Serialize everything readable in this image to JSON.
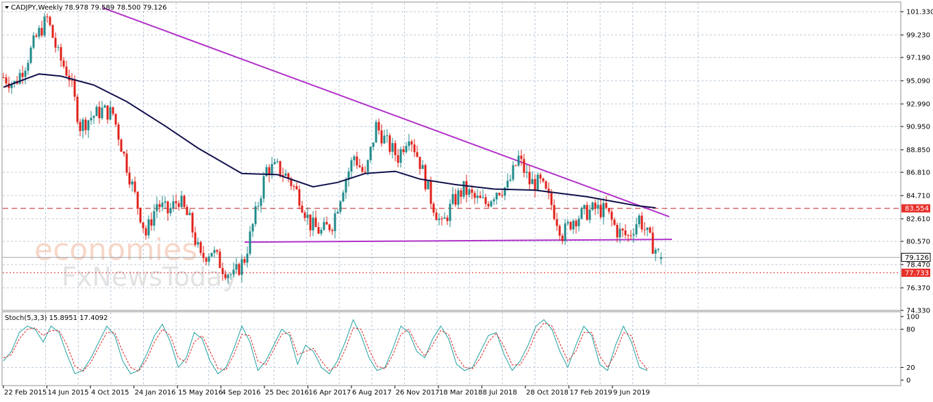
{
  "header": {
    "symbol": "CADJPY,Weekly",
    "ohlc": "78.978 79.589 78.500 79.126"
  },
  "watermark": {
    "line1": "economies",
    "line2": "FxNewsToday"
  },
  "colors": {
    "bull": "#1f8a8a",
    "bear": "#e0201a",
    "ma": "#10104a",
    "trend": "#b030c8",
    "res_line": "#c02020",
    "sup_line": "#e02020",
    "stoch_main": "#20a0a0",
    "stoch_signal": "#e02020",
    "grid": "#b8c8d8",
    "current": "#a0a8b0"
  },
  "chart_data": [
    {
      "type": "candlestick",
      "title": "CADJPY,Weekly",
      "ohlc_last": {
        "open": 78.978,
        "high": 79.589,
        "low": 78.5,
        "close": 79.126
      },
      "y_ticks": [
        "101.330",
        "99.230",
        "97.190",
        "95.090",
        "92.990",
        "90.950",
        "88.850",
        "86.810",
        "84.710",
        "82.610",
        "80.570",
        "78.470",
        "76.370",
        "74.330"
      ],
      "ylim": [
        74.33,
        102.2
      ],
      "x_labels": [
        "22 Feb 2015",
        "14 Jun 2015",
        "4 Oct 2015",
        "24 Jan 2016",
        "15 May 2016",
        "4 Sep 2016",
        "25 Dec 2016",
        "16 Apr 2017",
        "6 Aug 2017",
        "26 Nov 2017",
        "18 Mar 2018",
        "8 Jul 2018",
        "28 Oct 2018",
        "17 Feb 2019",
        "9 Jun 2019"
      ],
      "x_start": "2015-02-08",
      "x_end": "2019-11-24",
      "levels": [
        {
          "label": "83.554",
          "value": 83.554,
          "style": "dashed"
        },
        {
          "label": "77.733",
          "value": 77.733,
          "style": "dotted"
        },
        {
          "label": "79.126",
          "value": 79.126,
          "style": "current"
        }
      ],
      "trendlines": [
        {
          "from": {
            "date": "2015-10-18",
            "value": 101.7
          },
          "to": {
            "date": "2019-10-06",
            "value": 82.8
          }
        },
        {
          "from": {
            "date": "2016-10-16",
            "value": 80.5
          },
          "to": {
            "date": "2019-10-13",
            "value": 80.75
          }
        }
      ],
      "moving_average": [
        {
          "date": "2015-02-08",
          "value": 94.5
        },
        {
          "date": "2015-05-10",
          "value": 95.7
        },
        {
          "date": "2015-07-05",
          "value": 95.5
        },
        {
          "date": "2015-09-27",
          "value": 94.7
        },
        {
          "date": "2015-12-20",
          "value": 93.2
        },
        {
          "date": "2016-03-27",
          "value": 91.0
        },
        {
          "date": "2016-06-19",
          "value": 89.0
        },
        {
          "date": "2016-10-09",
          "value": 86.7
        },
        {
          "date": "2017-01-08",
          "value": 86.6
        },
        {
          "date": "2017-04-09",
          "value": 85.5
        },
        {
          "date": "2017-06-11",
          "value": 85.9
        },
        {
          "date": "2017-08-20",
          "value": 86.7
        },
        {
          "date": "2017-11-05",
          "value": 86.9
        },
        {
          "date": "2018-01-07",
          "value": 86.2
        },
        {
          "date": "2018-04-08",
          "value": 85.7
        },
        {
          "date": "2018-07-15",
          "value": 85.3
        },
        {
          "date": "2018-10-28",
          "value": 85.2
        },
        {
          "date": "2019-03-10",
          "value": 84.6
        },
        {
          "date": "2019-07-14",
          "value": 83.8
        },
        {
          "date": "2019-09-01",
          "value": 83.6
        }
      ],
      "candles": [
        [
          "2015-02-08",
          95.4
        ],
        [
          "2015-03-08",
          94.8
        ],
        [
          "2015-04-05",
          96.6
        ],
        [
          "2015-05-03",
          99.0
        ],
        [
          "2015-05-31",
          100.7
        ],
        [
          "2015-06-28",
          97.4
        ],
        [
          "2015-07-26",
          95.5
        ],
        [
          "2015-08-23",
          91.0
        ],
        [
          "2015-09-20",
          91.8
        ],
        [
          "2015-10-18",
          92.4
        ],
        [
          "2015-11-15",
          92.1
        ],
        [
          "2015-12-13",
          88.3
        ],
        [
          "2016-01-10",
          84.7
        ],
        [
          "2016-02-07",
          81.2
        ],
        [
          "2016-03-06",
          84.0
        ],
        [
          "2016-04-03",
          83.2
        ],
        [
          "2016-05-01",
          84.4
        ],
        [
          "2016-05-29",
          82.4
        ],
        [
          "2016-06-26",
          79.0
        ],
        [
          "2016-07-24",
          79.8
        ],
        [
          "2016-08-21",
          78.2
        ],
        [
          "2016-09-18",
          77.4
        ],
        [
          "2016-10-16",
          79.0
        ],
        [
          "2016-11-13",
          83.0
        ],
        [
          "2016-12-11",
          87.1
        ],
        [
          "2017-01-08",
          87.2
        ],
        [
          "2017-02-05",
          86.3
        ],
        [
          "2017-03-05",
          84.6
        ],
        [
          "2017-04-02",
          82.1
        ],
        [
          "2017-04-30",
          81.4
        ],
        [
          "2017-05-28",
          82.2
        ],
        [
          "2017-06-25",
          85.6
        ],
        [
          "2017-07-23",
          88.3
        ],
        [
          "2017-08-20",
          86.4
        ],
        [
          "2017-09-17",
          91.0
        ],
        [
          "2017-10-15",
          89.4
        ],
        [
          "2017-11-12",
          88.2
        ],
        [
          "2017-12-10",
          90.4
        ],
        [
          "2018-01-07",
          87.7
        ],
        [
          "2018-02-04",
          84.4
        ],
        [
          "2018-03-04",
          81.9
        ],
        [
          "2018-04-01",
          84.1
        ],
        [
          "2018-04-29",
          85.3
        ],
        [
          "2018-05-27",
          84.4
        ],
        [
          "2018-06-24",
          84.0
        ],
        [
          "2018-07-22",
          85.2
        ],
        [
          "2018-08-19",
          85.5
        ],
        [
          "2018-09-16",
          88.1
        ],
        [
          "2018-10-14",
          85.9
        ],
        [
          "2018-11-11",
          85.8
        ],
        [
          "2018-12-09",
          83.9
        ],
        [
          "2019-01-06",
          81.2
        ],
        [
          "2019-02-03",
          82.6
        ],
        [
          "2019-03-03",
          83.1
        ],
        [
          "2019-03-31",
          83.5
        ],
        [
          "2019-04-28",
          83.3
        ],
        [
          "2019-05-26",
          81.5
        ],
        [
          "2019-06-23",
          81.0
        ],
        [
          "2019-07-21",
          82.7
        ],
        [
          "2019-08-18",
          80.6
        ],
        [
          "2019-09-15",
          79.1
        ]
      ]
    },
    {
      "type": "line",
      "title": "Stoch(5,3,3) 15.8951 17.4092",
      "y_ticks": [
        "100",
        "80",
        "20",
        "0"
      ],
      "ylim": [
        0,
        100
      ],
      "series": [
        {
          "values": [
            30,
            45,
            75,
            85,
            80,
            60,
            85,
            75,
            40,
            10,
            15,
            35,
            60,
            85,
            70,
            30,
            10,
            15,
            40,
            70,
            88,
            60,
            20,
            35,
            75,
            65,
            30,
            10,
            20,
            50,
            85,
            60,
            15,
            30,
            55,
            80,
            70,
            25,
            55,
            45,
            20,
            10,
            30,
            60,
            95,
            70,
            35,
            15,
            20,
            50,
            85,
            75,
            45,
            35,
            65,
            85,
            65,
            25,
            15,
            20,
            45,
            70,
            75,
            40,
            15,
            30,
            55,
            85,
            95,
            80,
            45,
            20,
            55,
            85,
            70,
            25,
            15,
            55,
            85,
            60,
            20,
            15
          ]
        },
        {
          "values": [
            35,
            40,
            65,
            80,
            82,
            70,
            78,
            78,
            55,
            22,
            14,
            28,
            52,
            75,
            75,
            45,
            20,
            14,
            32,
            60,
            80,
            70,
            35,
            28,
            60,
            70,
            45,
            18,
            16,
            40,
            72,
            70,
            30,
            24,
            48,
            72,
            75,
            40,
            45,
            50,
            30,
            15,
            22,
            48,
            82,
            80,
            48,
            22,
            18,
            40,
            72,
            80,
            55,
            38,
            55,
            78,
            72,
            38,
            20,
            18,
            35,
            60,
            74,
            52,
            24,
            24,
            45,
            74,
            90,
            85,
            58,
            30,
            45,
            75,
            75,
            38,
            20,
            42,
            75,
            70,
            32,
            17
          ]
        }
      ]
    }
  ]
}
